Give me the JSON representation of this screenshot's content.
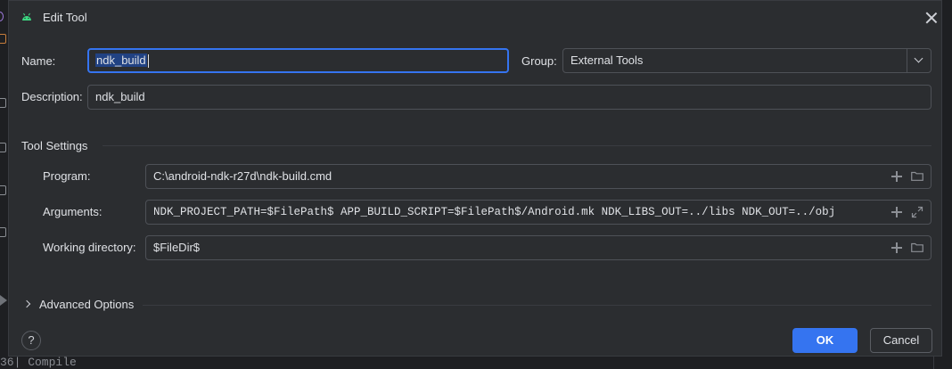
{
  "dialog": {
    "title": "Edit Tool",
    "name_label": "Name:",
    "name_value": "ndk_build",
    "group_label": "Group:",
    "group_value": "External Tools",
    "description_label": "Description:",
    "description_value": "ndk_build"
  },
  "tool_settings": {
    "section_title": "Tool Settings",
    "program_label": "Program:",
    "program_value": "C:\\android-ndk-r27d\\ndk-build.cmd",
    "arguments_label": "Arguments:",
    "arguments_value": "NDK_PROJECT_PATH=$FilePath$ APP_BUILD_SCRIPT=$FilePath$/Android.mk NDK_LIBS_OUT=../libs NDK_OUT=../obj",
    "working_dir_label": "Working directory:",
    "working_dir_value": "$FileDir$"
  },
  "advanced": {
    "label": "Advanced Options"
  },
  "footer": {
    "help_label": "?",
    "ok_label": "OK",
    "cancel_label": "Cancel"
  },
  "background": {
    "bottom_code": "36| Compile"
  },
  "colors": {
    "accent": "#3574f0",
    "dialog_bg": "#2b2d30",
    "android_green": "#3ddc84"
  }
}
